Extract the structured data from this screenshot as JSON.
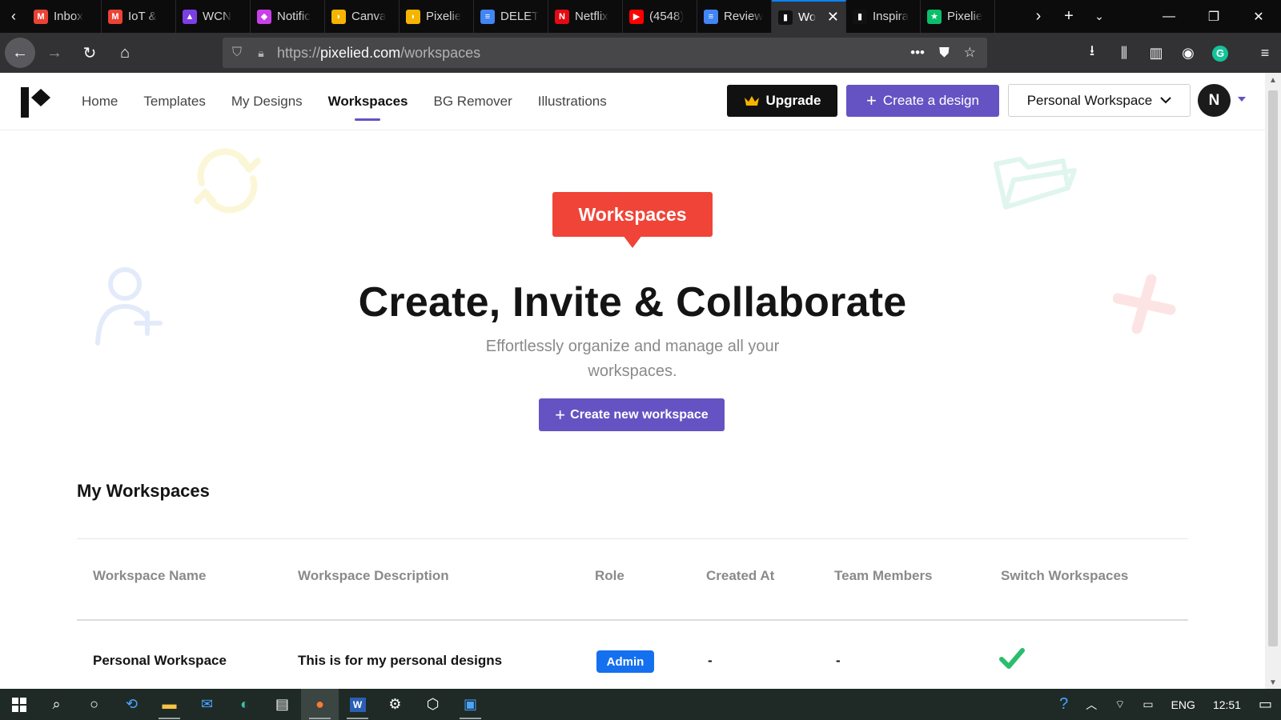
{
  "browser": {
    "tabs": [
      {
        "label": "Inbox",
        "favicon": "gmail-icon",
        "color": "#ea4335",
        "glyph": "M"
      },
      {
        "label": "IoT &",
        "favicon": "gmail-icon",
        "color": "#ea4335",
        "glyph": "M"
      },
      {
        "label": "WCN",
        "favicon": "profile-icon",
        "color": "#7b3fe4",
        "glyph": "▲"
      },
      {
        "label": "Notific",
        "favicon": "clickup-icon",
        "color": "#c940e8",
        "glyph": "◆"
      },
      {
        "label": "Canva",
        "favicon": "canva-icon",
        "color": "#f5b400",
        "glyph": "◗"
      },
      {
        "label": "Pixelie",
        "favicon": "pixelied-icon",
        "color": "#f5b400",
        "glyph": "◗"
      },
      {
        "label": "DELET",
        "favicon": "docs-icon",
        "color": "#4285f4",
        "glyph": "≡"
      },
      {
        "label": "Netflix",
        "favicon": "netflix-icon",
        "color": "#e50914",
        "glyph": "N"
      },
      {
        "label": "(4548)",
        "favicon": "youtube-icon",
        "color": "#ff0000",
        "glyph": "▶"
      },
      {
        "label": "Review",
        "favicon": "docs-icon",
        "color": "#4285f4",
        "glyph": "≡"
      },
      {
        "label": "Wo",
        "favicon": "pixelied-logo-icon",
        "color": "#111111",
        "glyph": "▮",
        "active": true
      },
      {
        "label": "Inspira",
        "favicon": "pixelied-logo-icon",
        "color": "#111111",
        "glyph": "▮"
      },
      {
        "label": "Pixelie",
        "favicon": "star-icon",
        "color": "#0bbf6a",
        "glyph": "★"
      }
    ],
    "url_scheme": "https://",
    "url_host": "pixelied.com",
    "url_path": "/workspaces"
  },
  "header": {
    "menu": [
      {
        "label": "Home"
      },
      {
        "label": "Templates"
      },
      {
        "label": "My Designs"
      },
      {
        "label": "Workspaces",
        "active": true
      },
      {
        "label": "BG Remover"
      },
      {
        "label": "Illustrations"
      }
    ],
    "upgrade_label": "Upgrade",
    "create_label": "Create a design",
    "workspace_selected": "Personal Workspace",
    "avatar_initial": "N"
  },
  "hero": {
    "badge": "Workspaces",
    "title": "Create, Invite & Collaborate",
    "subtitle": "Effortlessly organize and manage all your workspaces.",
    "cta": "Create new workspace"
  },
  "workspaces": {
    "section_title": "My Workspaces",
    "columns": [
      "Workspace Name",
      "Workspace Description",
      "Role",
      "Created At",
      "Team Members",
      "Switch Workspaces"
    ],
    "rows": [
      {
        "name": "Personal Workspace",
        "description": "This is for my personal designs",
        "role": "Admin",
        "created_at": "-",
        "team_members": "-",
        "switch": "check-icon"
      }
    ]
  },
  "taskbar": {
    "language": "ENG",
    "time": "12:51"
  },
  "colors": {
    "accent": "#6553c3",
    "badge_red": "#f04438",
    "role_blue": "#1570ef",
    "check_green": "#2bbd6e"
  }
}
